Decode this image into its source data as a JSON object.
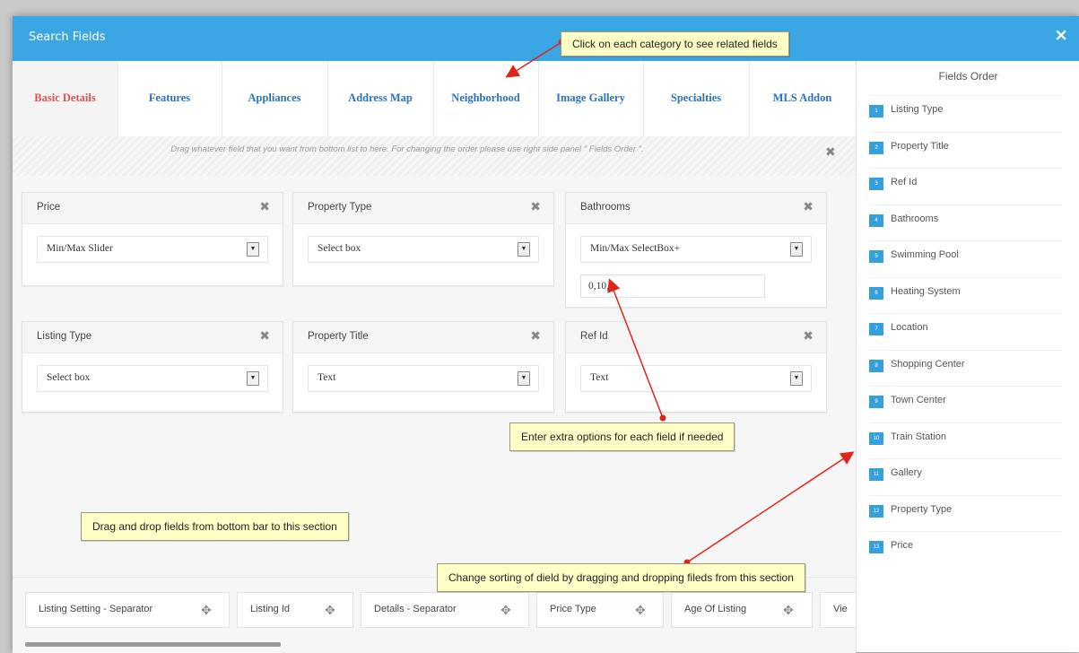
{
  "window": {
    "title": "Search Fields",
    "close": "×"
  },
  "tabs": [
    {
      "label": "Basic Details",
      "active": true
    },
    {
      "label": "Features",
      "active": false
    },
    {
      "label": "Appliances",
      "active": false
    },
    {
      "label": "Address Map",
      "active": false
    },
    {
      "label": "Neighborhood",
      "active": false
    },
    {
      "label": "Image Gallery",
      "active": false
    },
    {
      "label": "Specialties",
      "active": false
    },
    {
      "label": "MLS Addon",
      "active": false
    }
  ],
  "drop_hint": "Drag whatever field that you want from bottom list to here. For changing the order please use right side panel \" Fields Order \".",
  "fields": [
    {
      "title": "Price",
      "type": "Min/Max Slider",
      "extra": null
    },
    {
      "title": "Property Type",
      "type": "Select box",
      "extra": null
    },
    {
      "title": "Bathrooms",
      "type": "Min/Max SelectBox+",
      "extra": "0,10,1"
    },
    {
      "title": "Listing Type",
      "type": "Select box",
      "extra": null
    },
    {
      "title": "Property Title",
      "type": "Text",
      "extra": null
    },
    {
      "title": "Ref Id",
      "type": "Text",
      "extra": null
    }
  ],
  "fields_order": {
    "title": "Fields Order",
    "items": [
      {
        "num": "1",
        "label": "Listing Type"
      },
      {
        "num": "2",
        "label": "Property Title"
      },
      {
        "num": "3",
        "label": "Ref Id"
      },
      {
        "num": "4",
        "label": "Bathrooms"
      },
      {
        "num": "5",
        "label": "Swimming Pool"
      },
      {
        "num": "6",
        "label": "Heating System"
      },
      {
        "num": "7",
        "label": "Location"
      },
      {
        "num": "8",
        "label": "Shopping Center"
      },
      {
        "num": "9",
        "label": "Town Center"
      },
      {
        "num": "10",
        "label": "Train Station"
      },
      {
        "num": "11",
        "label": "Gallery"
      },
      {
        "num": "12",
        "label": "Property Type"
      },
      {
        "num": "13",
        "label": "Price"
      }
    ]
  },
  "available_fields": [
    "Listing Setting - Separator",
    "Listing Id",
    "Details - Separator",
    "Price Type",
    "Age Of Listing",
    "Vie"
  ],
  "callouts": {
    "category": "Click on each category to see related fields",
    "extra_options": "Enter extra options for each field if needed",
    "drag_drop": "Drag and drop fields from bottom bar to this section",
    "sorting": "Change sorting of dield by dragging and dropping fileds from this section"
  },
  "icons": {
    "remove": "remove-x-icon",
    "move": "move-arrows-icon",
    "dropdown": "dropdown-arrow-icon"
  },
  "colors": {
    "titlebar": "#3aa6e3",
    "active_tab": "#d9534f",
    "tab_text": "#2b72c2",
    "order_badge": "#36a0db",
    "callout_bg": "#fefec6",
    "arrow": "#e0241b"
  }
}
